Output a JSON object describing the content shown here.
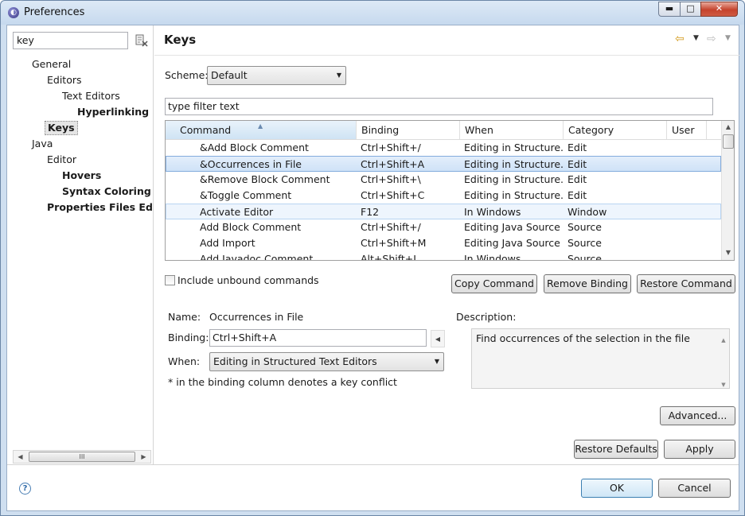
{
  "window": {
    "title": "Preferences",
    "min_glyph": "▬",
    "max_glyph": "□",
    "close_glyph": "✕"
  },
  "sidebar": {
    "filter_value": "key",
    "tree": [
      {
        "label": "General"
      },
      {
        "label": "Editors"
      },
      {
        "label": "Text Editors"
      },
      {
        "label": "Hyperlinking"
      },
      {
        "label": "Keys"
      },
      {
        "label": "Java"
      },
      {
        "label": "Editor"
      },
      {
        "label": "Hovers"
      },
      {
        "label": "Syntax Coloring"
      },
      {
        "label": "Properties Files Edito"
      }
    ],
    "scroll_thumb_glyph": "III"
  },
  "page": {
    "title": "Keys",
    "scheme_label": "Scheme:",
    "scheme_value": "Default",
    "filter_value": "type filter text"
  },
  "table": {
    "columns": [
      "Command",
      "Binding",
      "When",
      "Category",
      "User"
    ],
    "rows": [
      {
        "command": "&Add Block Comment",
        "binding": "Ctrl+Shift+/",
        "when": "Editing in Structure...",
        "category": "Edit",
        "user": ""
      },
      {
        "command": "&Occurrences in File",
        "binding": "Ctrl+Shift+A",
        "when": "Editing in Structure...",
        "category": "Edit",
        "user": ""
      },
      {
        "command": "&Remove Block Comment",
        "binding": "Ctrl+Shift+\\",
        "when": "Editing in Structure...",
        "category": "Edit",
        "user": ""
      },
      {
        "command": "&Toggle Comment",
        "binding": "Ctrl+Shift+C",
        "when": "Editing in Structure...",
        "category": "Edit",
        "user": ""
      },
      {
        "command": "Activate Editor",
        "binding": "F12",
        "when": "In Windows",
        "category": "Window",
        "user": ""
      },
      {
        "command": "Add Block Comment",
        "binding": "Ctrl+Shift+/",
        "when": "Editing Java Source",
        "category": "Source",
        "user": ""
      },
      {
        "command": "Add Import",
        "binding": "Ctrl+Shift+M",
        "when": "Editing Java Source",
        "category": "Source",
        "user": ""
      },
      {
        "command": "Add Javadoc Comment",
        "binding": "Alt+Shift+J",
        "when": "In Windows",
        "category": "Source",
        "user": ""
      }
    ]
  },
  "controls": {
    "include_unbound_label": "Include unbound commands",
    "copy_command": "Copy Command",
    "remove_binding": "Remove Binding",
    "restore_command": "Restore Command"
  },
  "details": {
    "name_label": "Name:",
    "name_value": "Occurrences in File",
    "binding_label": "Binding:",
    "binding_value": "Ctrl+Shift+A",
    "when_label": "When:",
    "when_value": "Editing in Structured Text Editors",
    "conflict_note": "* in the binding column denotes a key conflict",
    "description_label": "Description:",
    "description_value": "Find occurrences of the selection in the file"
  },
  "buttons": {
    "advanced": "Advanced...",
    "restore_defaults": "Restore Defaults",
    "apply": "Apply",
    "ok": "OK",
    "cancel": "Cancel"
  }
}
